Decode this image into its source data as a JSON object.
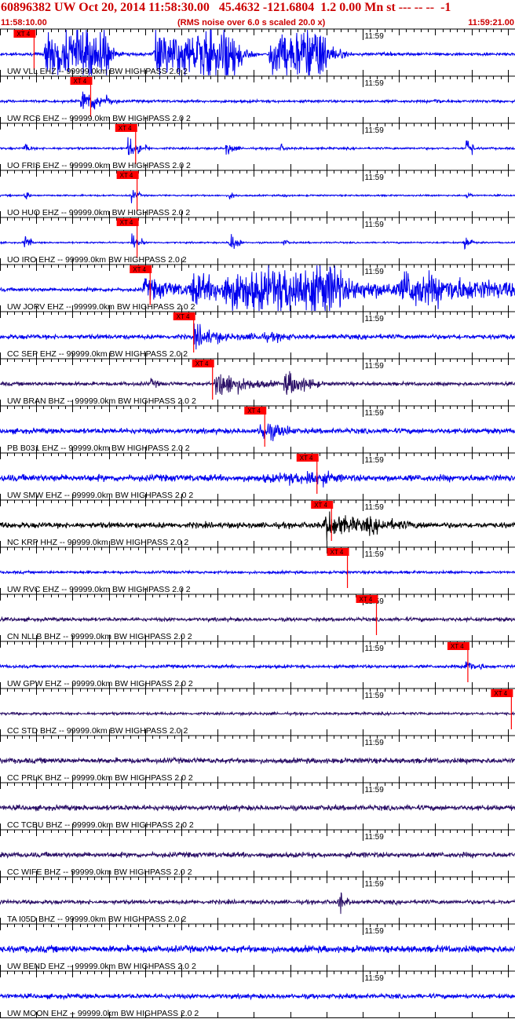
{
  "header": {
    "title": "60896382 UW Oct 20, 2014 11:58:30.00   45.4632 -121.6804  1.2 0.00 Mn st --- -- --  -1",
    "start_time": "11:58:10.00",
    "rms_note": "(RMS noise over 6.0 s scaled 20.0 x)",
    "end_time": "11:59:21.00"
  },
  "chart_data": {
    "type": "line",
    "title": "60896382 UW Oct 20, 2014 11:58:30.00   45.4632 -121.6804  1.2 0.00 Mn st --- -- --  -1",
    "x_range": [
      "11:58:10.00",
      "11:59:21.00"
    ],
    "x_range_seconds": [
      0,
      71
    ],
    "minute_tick_label": "11:59",
    "minute_tick_seconds": 50,
    "pick_label": "XT 4",
    "colors": {
      "title": "#cc0000",
      "pick": "#ff0000",
      "blue": "#0000ee",
      "navy": "#2a0f66",
      "black": "#000000"
    },
    "traces": [
      {
        "label": "UW VLL EHZ -- 99999.0km BW  HIGHPASS  2.0  2",
        "color": "blue",
        "pick_s": 3.4,
        "events": [
          [
            6,
            15,
            0.95,
            1.0,
            8
          ],
          [
            21,
            33,
            0.95,
            1.4,
            7
          ],
          [
            37,
            45,
            0.95,
            2.0,
            6
          ]
        ],
        "noise": 0.06
      },
      {
        "label": "UW RCS EHZ -- 99999.0km BW  HIGHPASS  2.0  2",
        "color": "blue",
        "pick_s": 11.2,
        "events": [
          [
            11.0,
            14.5,
            0.55,
            1.5,
            3
          ],
          [
            59.6,
            61.0,
            0.18,
            0.5,
            3
          ]
        ],
        "noise": 0.05
      },
      {
        "label": "UO FRIS EHZ -- 99999.0km BW  HIGHPASS  2.0  2",
        "color": "blue",
        "pick_s": 17.4,
        "events": [
          [
            3.2,
            4.2,
            0.25,
            0.4,
            3
          ],
          [
            17.5,
            19.0,
            0.75,
            0.4,
            2
          ],
          [
            20.0,
            20.5,
            0.3,
            0.3,
            2
          ],
          [
            31.0,
            32.5,
            0.28,
            0.6,
            3
          ],
          [
            38.5,
            39.5,
            0.2,
            0.4,
            3
          ],
          [
            64.2,
            65.0,
            0.8,
            0.3,
            2
          ]
        ],
        "noise": 0.04
      },
      {
        "label": "UO HUO EHZ -- 99999.0km BW  HIGHPASS  2.0  2",
        "color": "blue",
        "pick_s": 17.6,
        "events": [
          [
            3.3,
            4.1,
            0.25,
            0.3,
            3
          ],
          [
            18.0,
            19.0,
            0.45,
            0.3,
            2
          ],
          [
            31.5,
            32.5,
            0.2,
            0.4,
            3
          ],
          [
            39.0,
            39.8,
            0.12,
            0.3,
            3
          ],
          [
            64.2,
            65.0,
            0.2,
            0.3,
            3
          ]
        ],
        "noise": 0.03
      },
      {
        "label": "UO IRO EHZ -- 99999.0km BW  HIGHPASS  2.0  2",
        "color": "blue",
        "pick_s": 17.6,
        "events": [
          [
            3.2,
            4.2,
            0.35,
            0.3,
            3
          ],
          [
            18.0,
            19.5,
            0.45,
            0.3,
            2
          ],
          [
            31.5,
            33.0,
            0.45,
            0.4,
            3
          ],
          [
            39.0,
            40.0,
            0.15,
            0.3,
            3
          ],
          [
            63.8,
            65.0,
            0.35,
            0.3,
            3
          ]
        ],
        "noise": 0.03
      },
      {
        "label": "UW JORV EHZ -- 99999.0km BW  HIGHPASS  2.0  2",
        "color": "blue",
        "pick_s": 19.4,
        "events": [
          [
            19.5,
            29,
            0.45,
            4.0,
            3
          ],
          [
            26,
            34,
            0.7,
            4.0,
            3
          ],
          [
            30.5,
            47,
            0.95,
            14.0,
            4
          ],
          [
            47,
            55,
            0.45,
            6.0,
            3
          ],
          [
            55,
            71,
            0.8,
            14.0,
            3
          ]
        ],
        "noise": 0.07
      },
      {
        "label": "CC SEP EHZ -- 99999.0km BW  HIGHPASS  2.0  2",
        "color": "blue",
        "pick_s": 25.4,
        "events": [
          [
            26.5,
            30,
            0.55,
            1.8,
            3
          ],
          [
            30,
            40,
            0.15,
            5.0,
            4
          ]
        ],
        "noise": 0.09
      },
      {
        "label": "UW BRAN BHZ -- 99999.0km BW  HIGHPASS  2.0  2",
        "color": "navy",
        "pick_s": 28.0,
        "events": [
          [
            29.5,
            34,
            0.65,
            1.5,
            3
          ],
          [
            20.5,
            22.5,
            0.2,
            0.8,
            3
          ],
          [
            39,
            43,
            0.55,
            1.3,
            3
          ],
          [
            33,
            39,
            0.25,
            2.5,
            3
          ]
        ],
        "noise": 0.07
      },
      {
        "label": "PB B031 EHZ -- 99999.0km BW  HIGHPASS  2.0  2",
        "color": "blue",
        "pick_s": 35.2,
        "events": [
          [
            35.5,
            39.5,
            0.5,
            1.6,
            3
          ]
        ],
        "noise": 0.1
      },
      {
        "label": "UW SMW EHZ -- 99999.0km BW  HIGHPASS  2.0  2",
        "color": "blue",
        "pick_s": 42.4,
        "events": [
          [
            42.0,
            46.5,
            0.45,
            1.5,
            3
          ],
          [
            36,
            42,
            0.2,
            2.5,
            4
          ]
        ],
        "noise": 0.13
      },
      {
        "label": "NC KRP HHZ -- 99999.0km BW  HIGHPASS  2.0  2",
        "color": "black",
        "pick_s": 44.4,
        "events": [
          [
            44.5,
            50,
            0.62,
            2.8,
            3
          ],
          [
            50,
            58,
            0.35,
            3.5,
            3
          ]
        ],
        "noise": 0.11
      },
      {
        "label": "UW RVC EHZ -- 99999.0km BW  HIGHPASS  2.0  2",
        "color": "blue",
        "pick_s": 46.6,
        "events": [],
        "noise": 0.05
      },
      {
        "label": "CN NLLB BHZ -- 99999.0km BW  HIGHPASS  2.0  2",
        "color": "navy",
        "pick_s": 50.6,
        "events": [],
        "noise": 0.07
      },
      {
        "label": "UW GPW EHZ -- 99999.0km BW  HIGHPASS  2.0  2",
        "color": "blue",
        "pick_s": 63.2,
        "events": [
          [
            64.0,
            66.0,
            0.55,
            0.6,
            2
          ]
        ],
        "noise": 0.06
      },
      {
        "label": "CC STD BHZ -- 99999.0km BW  HIGHPASS  2.0  2",
        "color": "navy",
        "pick_s": 69.2,
        "events": [],
        "noise": 0.05
      },
      {
        "label": "CC PRLK BHZ -- 99999.0km BW  HIGHPASS  2.0  2",
        "color": "navy",
        "pick_s": null,
        "events": [],
        "noise": 0.1
      },
      {
        "label": "CC TCBU BHZ -- 99999.0km BW  HIGHPASS  2.0  2",
        "color": "navy",
        "pick_s": null,
        "events": [],
        "noise": 0.1
      },
      {
        "label": "CC WIFE BHZ -- 99999.0km BW  HIGHPASS  2.0  2",
        "color": "navy",
        "pick_s": null,
        "events": [],
        "noise": 0.1
      },
      {
        "label": "TA I05D BHZ -- 99999.0km BW  HIGHPASS  2.0  2",
        "color": "navy",
        "pick_s": null,
        "events": [
          [
            46.6,
            47.8,
            0.75,
            0.35,
            2
          ]
        ],
        "noise": 0.08
      },
      {
        "label": "UW BEND EHZ -- 99999.0km BW  HIGHPASS  2.0  2",
        "color": "blue",
        "pick_s": null,
        "events": [],
        "noise": 0.13
      },
      {
        "label": "UW MOON EHZ -- 99999.0km BW  HIGHPASS  2.0  2",
        "color": "blue",
        "pick_s": null,
        "events": [],
        "noise": 0.09
      }
    ]
  }
}
